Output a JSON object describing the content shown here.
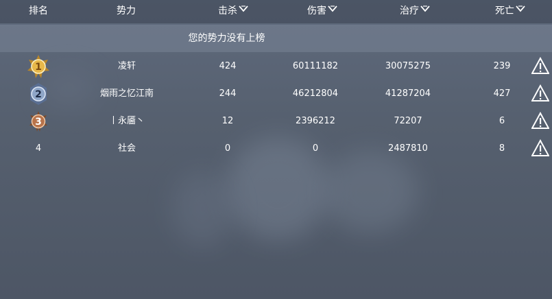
{
  "header": {
    "rank": "排名",
    "faction": "势力",
    "kills": "击杀",
    "damage": "伤害",
    "healing": "治疗",
    "deaths": "死亡"
  },
  "notice": "您的势力没有上榜",
  "rows": [
    {
      "rank": "1",
      "faction": "凌轩",
      "kills": "424",
      "damage": "60111182",
      "healing": "30075275",
      "deaths": "239"
    },
    {
      "rank": "2",
      "faction": "烟雨之忆江南",
      "kills": "244",
      "damage": "46212804",
      "healing": "41287204",
      "deaths": "427"
    },
    {
      "rank": "3",
      "faction": "丨永靥丶",
      "kills": "12",
      "damage": "2396212",
      "healing": "72207",
      "deaths": "6"
    },
    {
      "rank": "4",
      "faction": "社会",
      "kills": "0",
      "damage": "0",
      "healing": "2487810",
      "deaths": "8"
    }
  ],
  "icons": {
    "sort": "chevron-down-icon",
    "medal_gold": "gold-medal-icon",
    "medal_silver": "silver-medal-icon",
    "medal_bronze": "bronze-medal-icon",
    "report": "warning-icon"
  },
  "colors": {
    "gold": "#e8b84a",
    "silver": "#8fa6c8",
    "bronze": "#b8734a"
  }
}
